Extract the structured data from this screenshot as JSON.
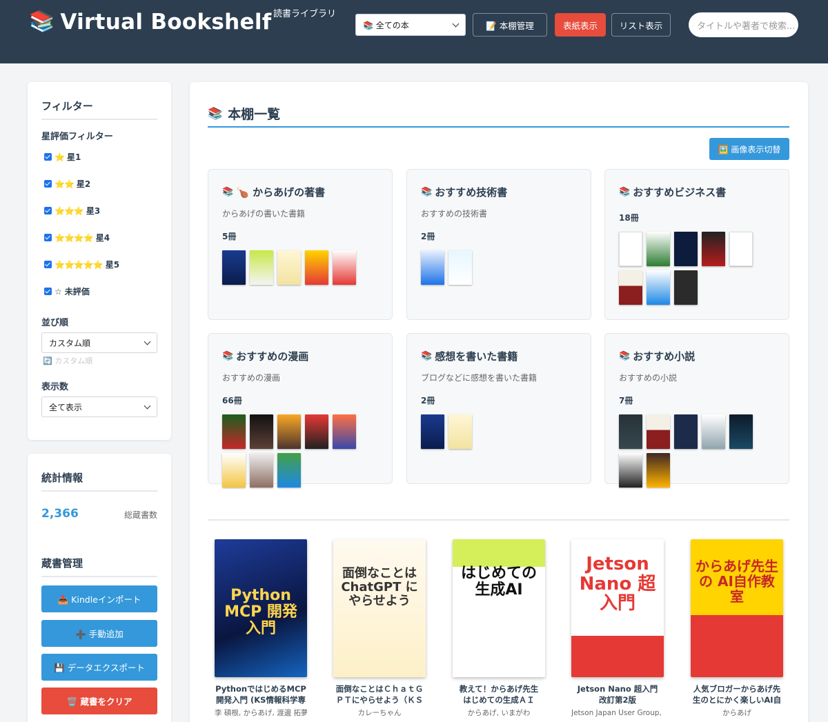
{
  "header": {
    "icon": "books-icon",
    "title": "Virtual Bookshelf",
    "subtitle": "読書ライブラリ",
    "book_select": "📚 全ての本",
    "manage_btn": "📝 本棚管理",
    "cover_btn": "表紙表示",
    "list_btn": "リスト表示",
    "search_placeholder": "タイトルや著者で検索..."
  },
  "sidebar": {
    "filter_title": "フィルター",
    "rating_title": "星評価フィルター",
    "ratings": [
      {
        "stars": "⭐",
        "label": "星1"
      },
      {
        "stars": "⭐⭐",
        "label": "星2"
      },
      {
        "stars": "⭐⭐⭐",
        "label": "星3"
      },
      {
        "stars": "⭐⭐⭐⭐",
        "label": "星4"
      },
      {
        "stars": "⭐⭐⭐⭐⭐",
        "label": "星5"
      },
      {
        "stars": "☆",
        "label": "未評価"
      }
    ],
    "sort_title": "並び順",
    "sort_value": "カスタム順",
    "sort_hint": "🔄 カスタム順",
    "display_title": "表示数",
    "display_value": "全て表示",
    "stats_title": "統計情報",
    "total_count": "2,366",
    "total_label": "総蔵書数",
    "manage_title": "蔵書管理",
    "kindle_btn": "📥 Kindleインポート",
    "add_btn": "➕ 手動追加",
    "export_btn": "💾 データエクスポート",
    "clear_btn": "🗑️ 蔵書をクリア"
  },
  "main": {
    "title": "本棚一覧",
    "toggle_btn": "🖼️ 画像表示切替",
    "shelves": [
      {
        "title": "🍗 からあげの著書",
        "desc": "からあげの書いた書籍",
        "count": "5冊"
      },
      {
        "title": "おすすめ技術書",
        "desc": "おすすめの技術書",
        "count": "2冊"
      },
      {
        "title": "おすすめビジネス書",
        "desc": "",
        "count": "18冊"
      },
      {
        "title": "おすすめの漫画",
        "desc": "おすすめの漫画",
        "count": "66冊"
      },
      {
        "title": "感想を書いた書籍",
        "desc": "ブログなどに感想を書いた書籍",
        "count": "2冊"
      },
      {
        "title": "おすすめ小説",
        "desc": "おすすめの小説",
        "count": "7冊"
      }
    ],
    "books": [
      {
        "title": "PythonではじめるMCP開発入門 (KS情報科学専門...",
        "author": "李 碩根, からあげ, 渡邊 拓夢",
        "cover_text": "Python MCP 開発入門"
      },
      {
        "title": "面倒なことはＣｈａｔＧＰＴにやらせよう（ＫＳ情...",
        "author": "カレーちゃん",
        "cover_text": "面倒なことは ChatGPT にやらせよう"
      },
      {
        "title": "教えて！からあげ先生　はじめての生成ＡＩ",
        "author": "からあげ, いまがわ",
        "cover_text": "はじめての 生成AI"
      },
      {
        "title": "Jetson Nano 超入門　改訂第2版",
        "author": "Jetson Japan User Group, か...",
        "cover_text": "Jetson Nano 超入門"
      },
      {
        "title": "人気ブロガーからあげ先生のとにかく楽しいAI自作...",
        "author": "からあげ",
        "cover_text": "からあげ先生の AI自作教室"
      }
    ]
  },
  "colors": {
    "header_bg": "#2c3e50",
    "accent_blue": "#3498db",
    "accent_red": "#e74c3c",
    "page_bg": "#f3f4f6"
  }
}
